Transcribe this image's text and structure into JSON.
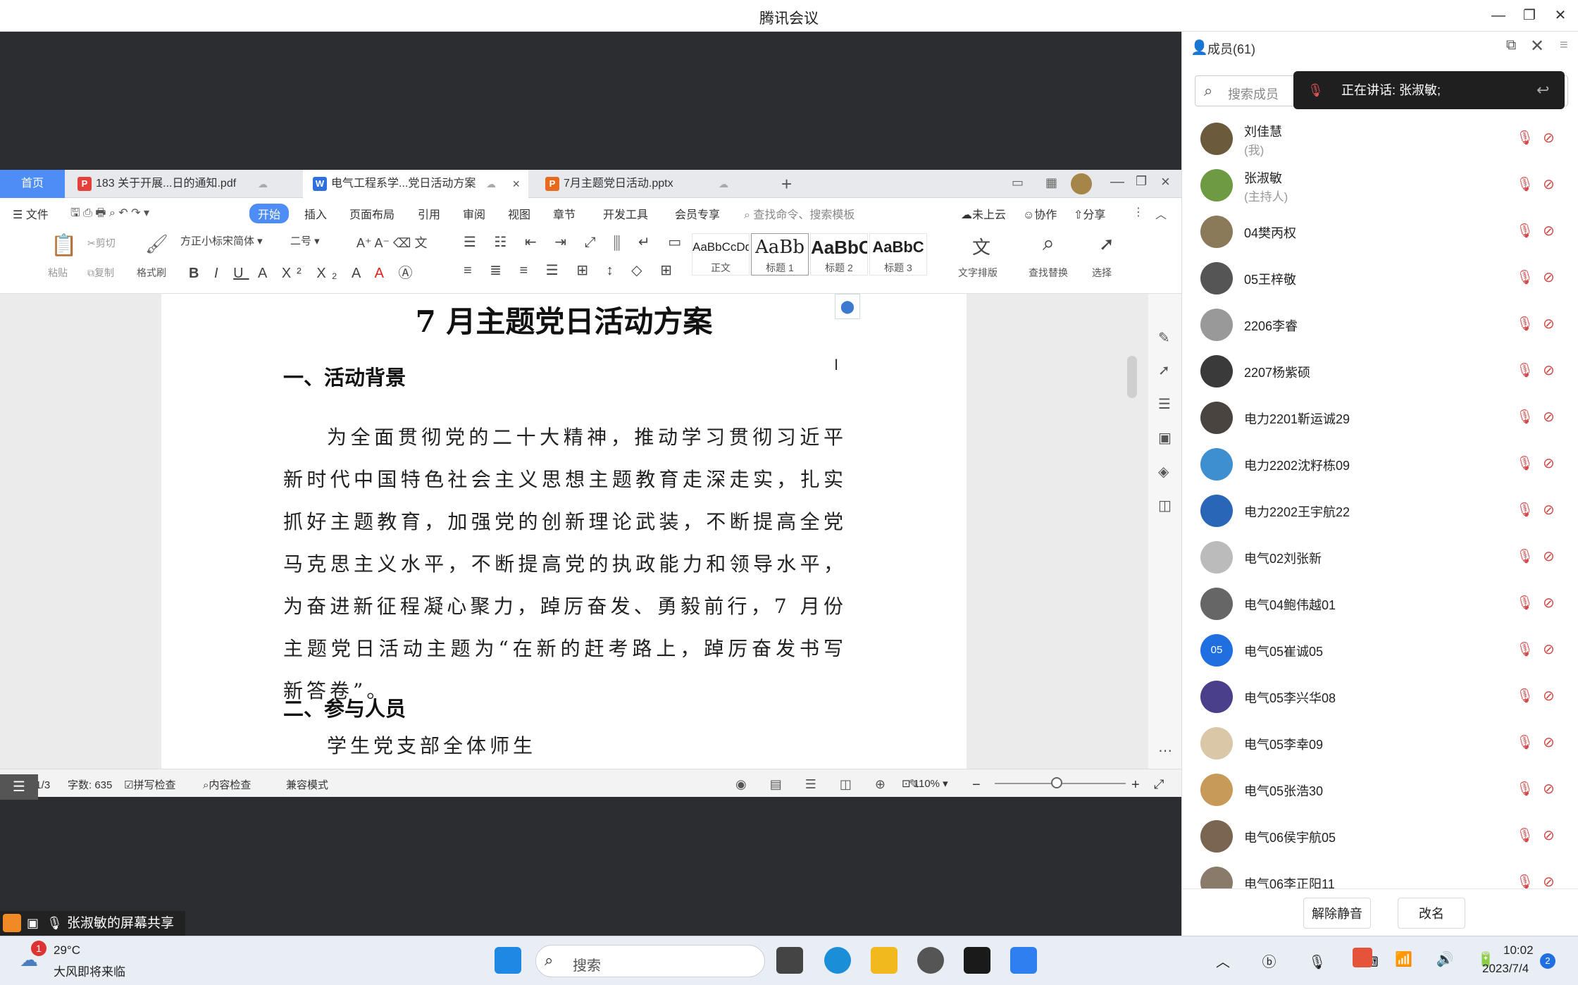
{
  "window": {
    "title": "腾讯会议"
  },
  "wps": {
    "tabs": [
      {
        "label": "首页"
      },
      {
        "label": "183 关于开展...日的通知.pdf"
      },
      {
        "label": "电气工程系学...党日活动方案"
      },
      {
        "label": "7月主题党日活动.pptx"
      }
    ],
    "menu": {
      "file": "文件",
      "items": [
        "开始",
        "插入",
        "页面布局",
        "引用",
        "审阅",
        "视图",
        "章节",
        "开发工具",
        "会员专享"
      ],
      "search": "查找命令、搜索模板",
      "cloud": "未上云",
      "collab": "协作",
      "share": "分享"
    },
    "ribbon": {
      "paste": "粘贴",
      "cut": "剪切",
      "copy": "复制",
      "format_painter": "格式刷",
      "font": "方正小标宋简体",
      "size": "二号",
      "styles": [
        {
          "sample": "AaBbCcDd",
          "name": "正文"
        },
        {
          "sample": "AaBb",
          "name": "标题 1"
        },
        {
          "sample": "AaBbC",
          "name": "标题 2"
        },
        {
          "sample": "AaBbC",
          "name": "标题 3"
        }
      ],
      "text_layout": "文字排版",
      "find_replace": "查找替换",
      "select": "选择"
    },
    "doc": {
      "title": "7 月主题党日活动方案",
      "h1": "一、活动背景",
      "para": "为全面贯彻党的二十大精神，推动学习贯彻习近平新时代中国特色社会主义思想主题教育走深走实，扎实抓好主题教育，加强党的创新理论武装，不断提高全党马克思主义水平，不断提高党的执政能力和领导水平，为奋进新征程凝心聚力，踔厉奋发、勇毅前行，7 月份主题党日活动主题为“在新的赶考路上，踔厉奋发书写新答卷”。",
      "h2": "二、参与人员",
      "body2": "学生党支部全体师生"
    },
    "status": {
      "page": "页面: 1/3",
      "words": "字数: 635",
      "spell": "拼写检查",
      "content_check": "内容检查",
      "compat": "兼容模式",
      "zoom": "110%"
    }
  },
  "share_banner": "张淑敏的屏幕共享",
  "panel": {
    "title": "成员(61)",
    "search_placeholder": "搜索成员",
    "speaking": "正在讲话: 张淑敏;",
    "members": [
      {
        "name": "刘佳慧",
        "sub": "(我)",
        "color": "#6b5a3c"
      },
      {
        "name": "张淑敏",
        "sub": "(主持人)",
        "color": "#6f9a44"
      },
      {
        "name": "04樊丙权",
        "sub": "",
        "color": "#8a7a5a"
      },
      {
        "name": "05王梓敬",
        "sub": "",
        "color": "#555555"
      },
      {
        "name": "2206李睿",
        "sub": "",
        "color": "#999999"
      },
      {
        "name": "2207杨紫硕",
        "sub": "",
        "color": "#3a3a3a"
      },
      {
        "name": "电力2201靳运诚29",
        "sub": "",
        "color": "#4a4440"
      },
      {
        "name": "电力2202沈籽栋09",
        "sub": "",
        "color": "#3d8fd0"
      },
      {
        "name": "电力2202王宇航22",
        "sub": "",
        "color": "#2a66b8"
      },
      {
        "name": "电气02刘张新",
        "sub": "",
        "color": "#bbbbbb"
      },
      {
        "name": "电气04鲍伟越01",
        "sub": "",
        "color": "#666666"
      },
      {
        "name": "电气05崔诚05",
        "sub": "",
        "color": "#1f6fe0",
        "initial": "05"
      },
      {
        "name": "电气05李兴华08",
        "sub": "",
        "color": "#4a3f8a"
      },
      {
        "name": "电气05李幸09",
        "sub": "",
        "color": "#d9c7a8"
      },
      {
        "name": "电气05张浩30",
        "sub": "",
        "color": "#c89a5a"
      },
      {
        "name": "电气06侯宇航05",
        "sub": "",
        "color": "#7a6650"
      },
      {
        "name": "电气06李正阳11",
        "sub": "",
        "color": "#8a7a6a"
      }
    ],
    "unmute": "解除静音",
    "rename": "改名"
  },
  "taskbar": {
    "temp": "29°C",
    "weather": "大风即将来临",
    "badge": "1",
    "search": "搜索",
    "time": "10:02",
    "date": "2023/7/4",
    "notif": "2"
  }
}
